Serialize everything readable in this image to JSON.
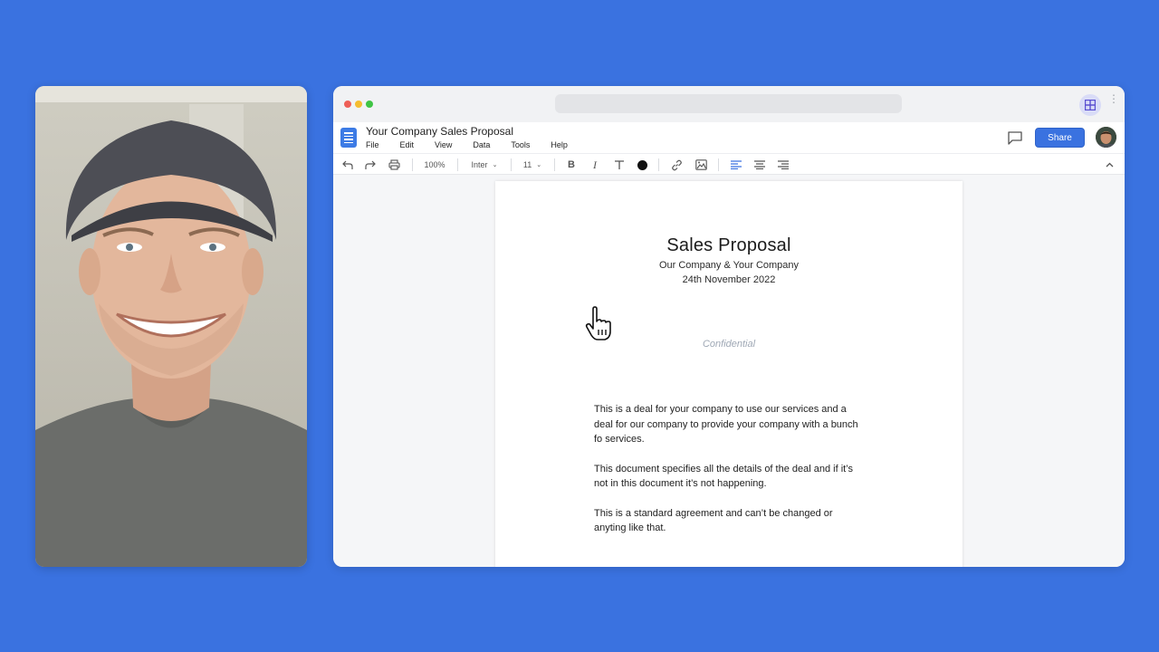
{
  "webcam": {
    "label": "presenter-camera"
  },
  "browser": {
    "url": "",
    "extension_icon": "layout-icon"
  },
  "app": {
    "doc_title": "Your Company Sales Proposal",
    "menu": [
      "File",
      "Edit",
      "View",
      "Data",
      "Tools",
      "Help"
    ],
    "share_label": "Share"
  },
  "toolbar": {
    "zoom": "100%",
    "font": "Inter",
    "font_size": "11",
    "text_color": "#111111",
    "icons": [
      "undo-icon",
      "redo-icon",
      "print-icon",
      "bold-icon",
      "italic-icon",
      "text-format-icon",
      "color-icon",
      "link-icon",
      "image-icon",
      "align-left-icon",
      "align-center-icon",
      "align-right-icon",
      "collapse-icon"
    ],
    "active_alignment": "left"
  },
  "document": {
    "heading": "Sales Proposal",
    "subtitle": "Our Company & Your Company",
    "date": "24th November 2022",
    "confidential": "Confidential",
    "paragraphs": [
      "This is a deal for your company to use our services and a deal for our company to provide your company with a bunch fo services.",
      "This document specifies all the details of the deal and if it’s not in this document it’s not happening.",
      "This is a standard agreement and can’t be changed or anyting like that."
    ]
  },
  "colors": {
    "background": "#3a72e0",
    "accent": "#3a72e0",
    "doc_logo": "#3d7be5"
  }
}
